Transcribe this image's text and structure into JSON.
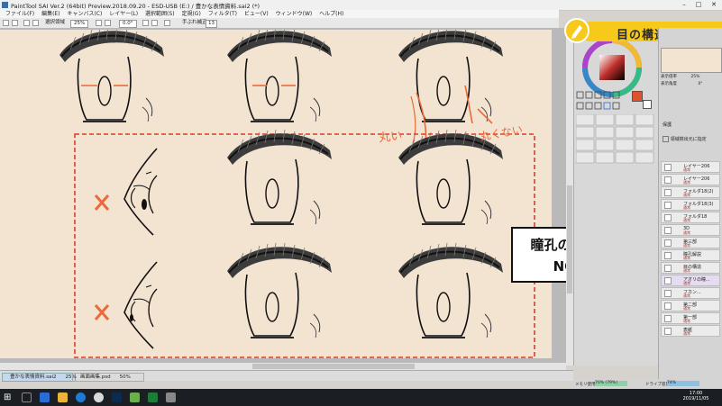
{
  "window": {
    "title": "PaintTool SAI Ver.2 (64bit) Preview.2018.09.20 - ESD-USB (E:) / 豊かな表情資料.sai2 (*)"
  },
  "menu": [
    "ファイル(F)",
    "編集(E)",
    "キャンバス(C)",
    "レイヤー(L)",
    "選択範囲(S)",
    "定規(G)",
    "フィルタ(T)",
    "ビュー(V)",
    "ウィンドウ(W)",
    "ヘルプ(H)"
  ],
  "toolbar": {
    "selection_label": "選択領域",
    "zoom": "25%",
    "angle": "0.0°",
    "stabilizer_label": "手ぶれ補正",
    "stabilizer_value": "13"
  },
  "banner": {
    "title": "目の構造"
  },
  "canvas": {
    "annotation_round": "丸い",
    "annotation_not_round": "丸くない",
    "caption_line1": "瞳孔の見え方",
    "caption_line2": "NG例"
  },
  "documents": [
    {
      "name": "豊かな表情資料.sai2",
      "zoom": "25%"
    },
    {
      "name": "画面画集.psd",
      "zoom": "50%"
    }
  ],
  "navigator": {
    "zoom_label": "表示倍率",
    "zoom_value": "25%",
    "angle_label": "表示角度",
    "angle_value": "0°"
  },
  "color_panel": {
    "accent": "#e0522a"
  },
  "layer_panel": {
    "protect_label": "保護",
    "clip_label": "領域検出元に指定",
    "layers": [
      {
        "name": "レイヤー206",
        "mode": "通常",
        "opacity": "100%"
      },
      {
        "name": "レイヤー206",
        "mode": "通常",
        "opacity": "100%"
      },
      {
        "name": "フォルダ18(2)",
        "mode": "通常",
        "opacity": "100%"
      },
      {
        "name": "フォルダ18(3)",
        "mode": "通常",
        "opacity": "100%"
      },
      {
        "name": "フォルダ18",
        "mode": "通常",
        "opacity": "100%"
      },
      {
        "name": "3D",
        "mode": "通常",
        "opacity": "100%"
      },
      {
        "name": "第三部",
        "mode": "通常",
        "opacity": "100%"
      },
      {
        "name": "瞳孔解説",
        "mode": "通常",
        "opacity": "100%"
      },
      {
        "name": "目の構造",
        "mode": "通常",
        "opacity": "100%"
      },
      {
        "name": "アオリの瞳...",
        "mode": "通常",
        "opacity": "100%"
      },
      {
        "name": "フカン...",
        "mode": "通常",
        "opacity": "100%"
      },
      {
        "name": "第二部",
        "mode": "通常",
        "opacity": "100%"
      },
      {
        "name": "第一部",
        "mode": "通常",
        "opacity": "100%"
      },
      {
        "name": "表紙",
        "mode": "通常",
        "opacity": "100%"
      }
    ]
  },
  "status": {
    "memory_label": "メモリ使用量",
    "memory_value": "70% (79%)",
    "drive_label": "ドライブ容量",
    "drive_value": "74%"
  },
  "taskbar": {
    "time": "17:00",
    "date": "2019/11/05"
  },
  "colors": {
    "canvas_bg": "#f3e3d1",
    "accent_orange": "#ea6a3a",
    "dashed_red": "#e03a2a",
    "banner_yellow": "#f7c91a"
  }
}
